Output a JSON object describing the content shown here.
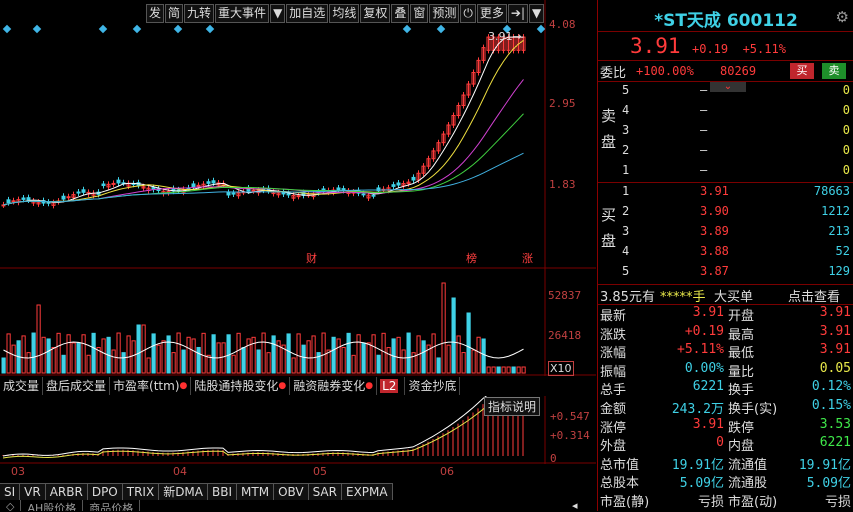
{
  "toolbar": {
    "items": [
      "发",
      "简",
      "九转",
      "重大事件",
      "▼",
      "加自选",
      "均线",
      "复权",
      "叠",
      "窗",
      "预测",
      "⏻",
      "更多",
      "➔|",
      "▼"
    ]
  },
  "price_axis": {
    "labels": [
      "4.08",
      "2.95",
      "1.83"
    ],
    "last_price_tag": "3.91"
  },
  "event_marks": [
    "财",
    "榜",
    "涨"
  ],
  "volume_axis": {
    "labels": [
      "52837",
      "26418",
      "X10"
    ]
  },
  "indicator_tabs": [
    "成交量",
    "盘后成交量",
    "市盈率(ttm)",
    "陆股通持股变化",
    "融资融券变化",
    "L2",
    "资金抄底"
  ],
  "indicator": {
    "help_button": "指标说明",
    "labels": [
      "+0.547",
      "+0.314",
      "0"
    ]
  },
  "time_axis": [
    "03",
    "04",
    "05",
    "06"
  ],
  "bottom_tabs": [
    "SI",
    "VR",
    "ARBR",
    "DPO",
    "TRIX",
    "新DMA",
    "BBI",
    "MTM",
    "OBV",
    "SAR",
    "EXPMA"
  ],
  "bottom_tabs2": [
    "AH股价格",
    "商品价格"
  ],
  "stock": {
    "name": "*ST天成 600112",
    "price": "3.91",
    "change": "+0.19",
    "change_pct": "+5.11%",
    "weibi_label": "委比",
    "weibi": "+100.00%",
    "weicha": "80269",
    "buy_btn": "买",
    "sell_btn": "卖"
  },
  "sell_side_label": [
    "卖",
    "盘"
  ],
  "buy_side_label": [
    "买",
    "盘"
  ],
  "asks": [
    {
      "level": "5",
      "price": "–",
      "vol": "0"
    },
    {
      "level": "4",
      "price": "–",
      "vol": "0"
    },
    {
      "level": "3",
      "price": "–",
      "vol": "0"
    },
    {
      "level": "2",
      "price": "–",
      "vol": "0"
    },
    {
      "level": "1",
      "price": "–",
      "vol": "0"
    }
  ],
  "bids": [
    {
      "level": "1",
      "price": "3.91",
      "vol": "78663"
    },
    {
      "level": "2",
      "price": "3.90",
      "vol": "1212"
    },
    {
      "level": "3",
      "price": "3.89",
      "vol": "213"
    },
    {
      "level": "4",
      "price": "3.88",
      "vol": "52"
    },
    {
      "level": "5",
      "price": "3.87",
      "vol": "129"
    }
  ],
  "bigorder": {
    "left": "3.85元有",
    "mid": "*****手",
    "tag": "大买单",
    "action": "点击查看"
  },
  "quotes": [
    {
      "l": "最新",
      "lv": "3.91",
      "lc": "red",
      "r": "开盘",
      "rv": "3.91",
      "rc": "red"
    },
    {
      "l": "涨跌",
      "lv": "+0.19",
      "lc": "red",
      "r": "最高",
      "rv": "3.91",
      "rc": "red"
    },
    {
      "l": "涨幅",
      "lv": "+5.11%",
      "lc": "red",
      "r": "最低",
      "rv": "3.91",
      "rc": "red"
    },
    {
      "l": "振幅",
      "lv": "0.00%",
      "lc": "cyan",
      "r": "量比",
      "rv": "0.05",
      "rc": "yel"
    },
    {
      "l": "总手",
      "lv": "6221",
      "lc": "cyan",
      "r": "换手",
      "rv": "0.12%",
      "rc": "cyan"
    },
    {
      "l": "金额",
      "lv": "243.2万",
      "lc": "cyan",
      "r": "换手(实)",
      "rv": "0.15%",
      "rc": "cyan"
    },
    {
      "l": "涨停",
      "lv": "3.91",
      "lc": "red",
      "r": "跌停",
      "rv": "3.53",
      "rc": "grn"
    },
    {
      "l": "外盘",
      "lv": "0",
      "lc": "red",
      "r": "内盘",
      "rv": "6221",
      "rc": "grn"
    },
    {
      "l": "总市值",
      "lv": "19.91亿",
      "lc": "cyan",
      "r": "流通值",
      "rv": "19.91亿",
      "rc": "cyan"
    },
    {
      "l": "总股本",
      "lv": "5.09亿",
      "lc": "cyan",
      "r": "流通股",
      "rv": "5.09亿",
      "rc": "cyan"
    },
    {
      "l": "市盈(静)",
      "lv": "亏损",
      "lc": "cn",
      "r": "市盈(动)",
      "rv": "亏损",
      "rc": "cn"
    }
  ],
  "colors": {
    "up": "#ff3b3b",
    "down": "#3fd1e6",
    "ma5": "#ffffff",
    "ma10": "#f0e040",
    "ma20": "#d040d0",
    "ma30": "#40d040",
    "ma60": "#40b0e0"
  }
}
